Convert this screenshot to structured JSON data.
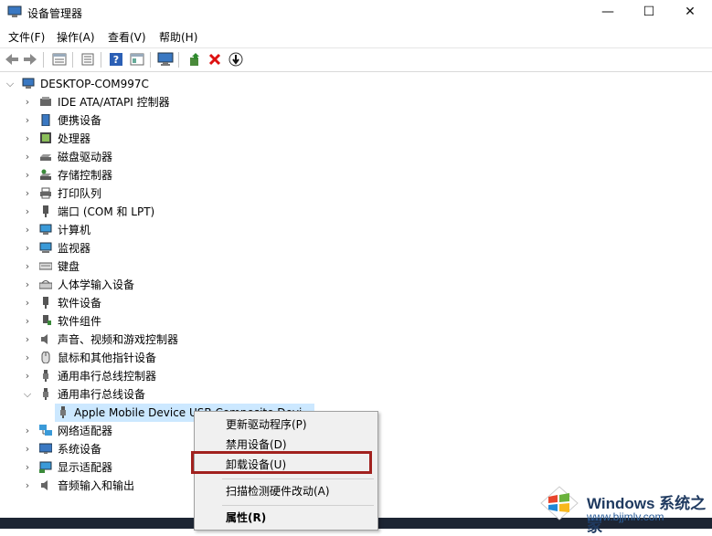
{
  "window": {
    "title": "设备管理器",
    "controls": {
      "minimize": "—",
      "maximize": "☐",
      "close": "✕"
    }
  },
  "menubar": {
    "items": [
      {
        "label": "文件(F)"
      },
      {
        "label": "操作(A)"
      },
      {
        "label": "查看(V)"
      },
      {
        "label": "帮助(H)"
      }
    ]
  },
  "toolbar": {
    "icons": [
      "back-icon",
      "forward-icon",
      "properties-icon",
      "update-list-icon",
      "help-icon",
      "view-icon",
      "monitor-icon",
      "add-driver-icon",
      "remove-icon",
      "download-icon"
    ]
  },
  "tree": {
    "root": "DESKTOP-COM997C",
    "categories": [
      {
        "label": "IDE ATA/ATAPI 控制器",
        "expanded": false
      },
      {
        "label": "便携设备",
        "expanded": false
      },
      {
        "label": "处理器",
        "expanded": false
      },
      {
        "label": "磁盘驱动器",
        "expanded": false
      },
      {
        "label": "存储控制器",
        "expanded": false
      },
      {
        "label": "打印队列",
        "expanded": false
      },
      {
        "label": "端口 (COM 和 LPT)",
        "expanded": false
      },
      {
        "label": "计算机",
        "expanded": false
      },
      {
        "label": "监视器",
        "expanded": false
      },
      {
        "label": "键盘",
        "expanded": false
      },
      {
        "label": "人体学输入设备",
        "expanded": false
      },
      {
        "label": "软件设备",
        "expanded": false
      },
      {
        "label": "软件组件",
        "expanded": false
      },
      {
        "label": "声音、视频和游戏控制器",
        "expanded": false
      },
      {
        "label": "鼠标和其他指针设备",
        "expanded": false
      },
      {
        "label": "通用串行总线控制器",
        "expanded": false
      },
      {
        "label": "通用串行总线设备",
        "expanded": true
      },
      {
        "label": "网络适配器",
        "expanded": false
      },
      {
        "label": "系统设备",
        "expanded": false
      },
      {
        "label": "显示适配器",
        "expanded": false
      },
      {
        "label": "音频输入和输出",
        "expanded": false
      }
    ],
    "child_device": "Apple Mobile Device USB Composite Devi"
  },
  "context_menu": {
    "items": [
      {
        "label": "更新驱动程序(P)"
      },
      {
        "label": "禁用设备(D)"
      },
      {
        "label": "卸载设备(U)"
      },
      {
        "label": "扫描检测硬件改动(A)"
      },
      {
        "label": "属性(R)"
      }
    ]
  },
  "watermark": {
    "brand": "Windows 系统之家",
    "url": "www.bjjmlv.com"
  },
  "colors": {
    "selection": "#cce8ff",
    "highlight_border": "#a1211e",
    "menu_bg": "#f0f0f0"
  }
}
